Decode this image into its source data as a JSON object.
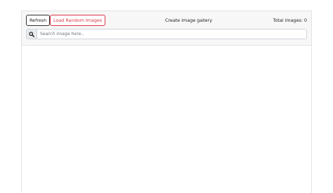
{
  "toolbar": {
    "refresh_label": "Refresh",
    "load_random_label": "Load Random Images",
    "title": "Create image gallery",
    "total_label": "Total images: 0"
  },
  "search": {
    "icon": "search-icon",
    "placeholder": "Search image here.."
  },
  "colors": {
    "danger": "#dc3545",
    "header_bg": "#f7f7f7",
    "border": "#e3e3e3"
  }
}
